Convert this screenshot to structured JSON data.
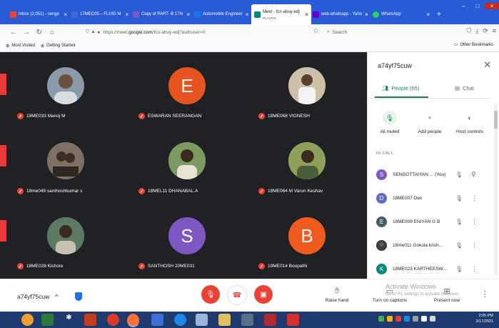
{
  "browser": {
    "tabs": [
      {
        "label": "Inbox (2,051) - sengo",
        "icon_color": "#ea4335"
      },
      {
        "label": "17MEC05 – FLUID M",
        "icon_color": "#3f6ad8"
      },
      {
        "label": "Copy of PART- B 17N",
        "icon_color": "#7b57c7"
      },
      {
        "label": "Automobile Engineer",
        "icon_color": "#1a73e8"
      },
      {
        "label": "Meet - fcn-ahuy-edj",
        "sublabel": "PLAYING",
        "icon_color": "#00897b"
      },
      {
        "label": "web.whatsapp - Yaho",
        "icon_color": "#6001d2"
      },
      {
        "label": "WhatsApp",
        "icon_color": "#25d366"
      }
    ],
    "url_prefix": "https://meet.",
    "url_domain": "google.com",
    "url_suffix": "/fcn-ahuy-edj?authuser=0",
    "search_placeholder": "Search",
    "bookmarks": [
      "Most Visited",
      "Getting Started"
    ],
    "other_bookmarks": "Other Bookmarks"
  },
  "tiles": [
    {
      "name": "18ME033 Manoj M",
      "avatar": "photo",
      "photo_color": "#8a9aa8"
    },
    {
      "name": "ESWARAN SEERANGAN",
      "avatar": "letter",
      "letter": "E",
      "color": "#e8541f"
    },
    {
      "name": "18ME068 VIGNESH",
      "avatar": "photo",
      "photo_color": "#b7a58f"
    },
    {
      "name": "18me049 santhoshkumar s",
      "avatar": "photo",
      "photo_color": "#6b5d52"
    },
    {
      "name": "18MEL11 DHANABAL.A",
      "avatar": "photo",
      "photo_color": "#6f8a5a"
    },
    {
      "name": "18ME064 M Varun Keshav",
      "avatar": "photo",
      "photo_color": "#7c8a4e"
    },
    {
      "name": "18ME028 Kishore",
      "avatar": "photo",
      "photo_color": "#4f6b5a"
    },
    {
      "name": "SANTHOSH 20ME031",
      "avatar": "letter",
      "letter": "S",
      "color": "#7e57c2"
    },
    {
      "name": "19ME014 Boopathi",
      "avatar": "letter",
      "letter": "B",
      "color": "#ef5a1e"
    }
  ],
  "panel": {
    "title": "a74yf75cuw",
    "people_tab": "People (65)",
    "chat_tab": "Chat",
    "actions": [
      {
        "label": "All muted",
        "icon": "mic-off-icon"
      },
      {
        "label": "Add people",
        "icon": "add-person-icon"
      },
      {
        "label": "Host controls",
        "icon": "toggle-icon"
      }
    ],
    "section": "IN CALL",
    "participants": [
      {
        "letter": "S",
        "name": "SENGOTTAIYAN ... (You)",
        "color": "#7e57c2",
        "pinnable": true
      },
      {
        "letter": "D",
        "name": "18ME007 Dev",
        "color": "#5c6bc0",
        "pinnable": false
      },
      {
        "letter": "E",
        "name": "18ME009 ENIYAN G B",
        "color": "#455a64",
        "pinnable": false
      },
      {
        "letter": "",
        "name": "18me011 Gokula krish...",
        "color": "#3e3e3e",
        "pinnable": false
      },
      {
        "letter": "K",
        "name": "18ME023 KARTHEESW...",
        "color": "#00897b",
        "pinnable": false
      }
    ]
  },
  "bottom": {
    "meeting_code": "a74yf75cuw",
    "raise_hand": "Raise hand",
    "captions": "Turn on captions",
    "present": "Present now",
    "watermark_title": "Activate Windows",
    "watermark_sub": "Go to PC settings to activate Windows."
  },
  "taskbar": {
    "time": "2:05 PM",
    "date": "3/17/2021"
  }
}
